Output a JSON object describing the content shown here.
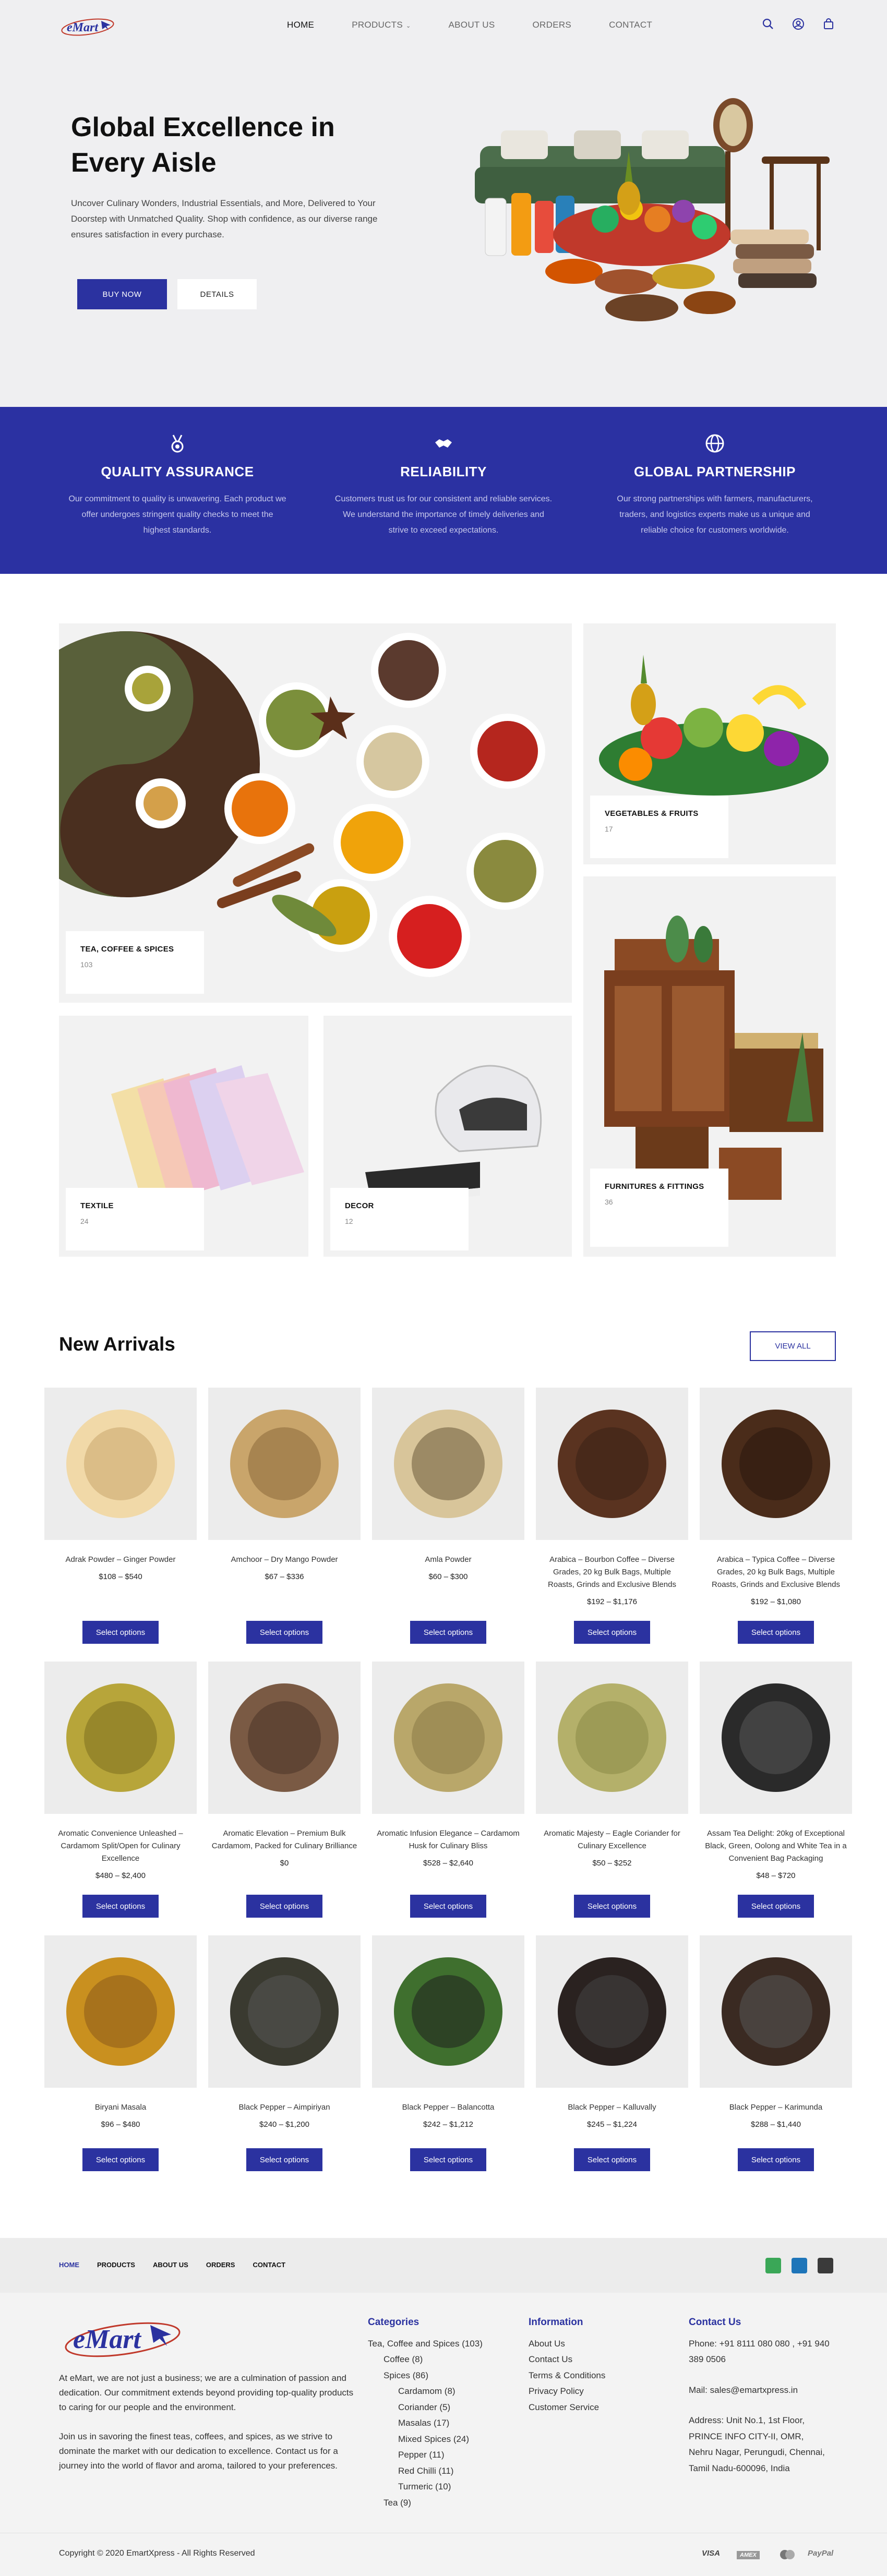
{
  "brand": {
    "logo_text": "eMart",
    "accent": "#2b32a0"
  },
  "nav": {
    "items": [
      "HOME",
      "PRODUCTS",
      "ABOUT US",
      "ORDERS",
      "CONTACT"
    ],
    "caret": "⌄"
  },
  "hero": {
    "title": "Global Excellence in Every Aisle",
    "text": "Uncover Culinary Wonders, Industrial Essentials, and More, Delivered to Your Doorstep with Unmatched Quality. Shop with confidence, as our diverse range ensures satisfaction in every purchase.",
    "buy_label": "BUY NOW",
    "details_label": "DETAILS"
  },
  "features": [
    {
      "title": "QUALITY ASSURANCE",
      "text": "Our commitment to quality is unwavering. Each product we offer undergoes stringent quality checks to meet the highest standards.",
      "icon": "medal-icon"
    },
    {
      "title": "RELIABILITY",
      "text": "Customers trust us for our consistent and reliable services. We understand the importance of timely deliveries and strive to exceed expectations.",
      "icon": "handshake-icon"
    },
    {
      "title": "GLOBAL PARTNERSHIP",
      "text": "Our strong partnerships with farmers, manufacturers, traders, and logistics experts make us a unique and reliable choice for customers worldwide.",
      "icon": "globe-icon"
    }
  ],
  "categories": [
    {
      "name": "TEA, COFFEE & SPICES",
      "count": "103"
    },
    {
      "name": "VEGETABLES & FRUITS",
      "count": "17"
    },
    {
      "name": "TEXTILE",
      "count": "24"
    },
    {
      "name": "DECOR",
      "count": "12"
    },
    {
      "name": "FURNITURES & FITTINGS",
      "count": "36"
    }
  ],
  "new_arrivals": {
    "title": "New Arrivals",
    "view_all": "VIEW ALL",
    "button_label": "Select options",
    "products": [
      {
        "name": "Adrak Powder – Ginger Powder",
        "price": "$108 – $540"
      },
      {
        "name": "Amchoor – Dry Mango Powder",
        "price": "$67 – $336"
      },
      {
        "name": "Amla Powder",
        "price": "$60 – $300"
      },
      {
        "name": "Arabica – Bourbon Coffee – Diverse Grades, 20 kg Bulk Bags, Multiple Roasts, Grinds and Exclusive Blends",
        "price": "$192 – $1,176"
      },
      {
        "name": "Arabica – Typica Coffee – Diverse Grades, 20 kg Bulk Bags, Multiple Roasts, Grinds and Exclusive Blends",
        "price": "$192 – $1,080"
      },
      {
        "name": "Aromatic Convenience Unleashed – Cardamom Split/Open for Culinary Excellence",
        "price": "$480 – $2,400"
      },
      {
        "name": "Aromatic Elevation – Premium Bulk Cardamom, Packed for Culinary Brilliance",
        "price": "$0"
      },
      {
        "name": "Aromatic Infusion Elegance – Cardamom Husk for Culinary Bliss",
        "price": "$528 – $2,640"
      },
      {
        "name": "Aromatic Majesty – Eagle Coriander for Culinary Excellence",
        "price": "$50 – $252"
      },
      {
        "name": "Assam Tea Delight: 20kg of Exceptional Black, Green, Oolong and White Tea in a Convenient Bag Packaging",
        "price": "$48 – $720"
      },
      {
        "name": "Biryani Masala",
        "price": "$96 – $480"
      },
      {
        "name": "Black Pepper – Aimpiriyan",
        "price": "$240 – $1,200"
      },
      {
        "name": "Black Pepper – Balancotta",
        "price": "$242 – $1,212"
      },
      {
        "name": "Black Pepper – Kalluvally",
        "price": "$245 – $1,224"
      },
      {
        "name": "Black Pepper – Karimunda",
        "price": "$288 – $1,440"
      }
    ]
  },
  "footer": {
    "nav": [
      "HOME",
      "PRODUCTS",
      "ABOUT US",
      "ORDERS",
      "CONTACT"
    ],
    "about_1": "At eMart, we are not just a business; we are a culmination of passion and dedication. Our commitment extends beyond providing top-quality products to caring for our people and the environment.",
    "about_2": "Join us in savoring the finest teas, coffees, and spices, as we strive to dominate the market with our dedication to excellence. Contact us for a journey into the world of flavor and aroma, tailored to your preferences.",
    "categories_title": "Categories",
    "categories": [
      {
        "label": "Tea, Coffee and Spices (103)",
        "level": 0
      },
      {
        "label": "Coffee (8)",
        "level": 1
      },
      {
        "label": "Spices (86)",
        "level": 1
      },
      {
        "label": "Cardamom (8)",
        "level": 2
      },
      {
        "label": "Coriander (5)",
        "level": 2
      },
      {
        "label": "Masalas (17)",
        "level": 2
      },
      {
        "label": "Mixed Spices (24)",
        "level": 2
      },
      {
        "label": "Pepper (11)",
        "level": 2
      },
      {
        "label": "Red Chilli (11)",
        "level": 2
      },
      {
        "label": "Turmeric (10)",
        "level": 2
      },
      {
        "label": "Tea (9)",
        "level": 1
      }
    ],
    "info_title": "Information",
    "info": [
      "About Us",
      "Contact Us",
      "Terms & Conditions",
      "Privacy Policy",
      "Customer Service"
    ],
    "contact_title": "Contact Us",
    "phone": "Phone: +91 8111 080 080 , +91 940 389 0506",
    "mail": "Mail: sales@emartxpress.in",
    "address": "Address: Unit No.1, 1st Floor, PRINCE INFO CITY-II, OMR, Nehru Nagar, Perungudi, Chennai, Tamil Nadu-600096, India",
    "copyright": "Copyright © 2020 EmartXpress - All Rights Reserved",
    "payments": [
      "VISA",
      "AMEX",
      "Mastercard",
      "PayPal"
    ],
    "social_colors": [
      "#3aa757",
      "#1e75b9",
      "#3a3a3a"
    ]
  }
}
